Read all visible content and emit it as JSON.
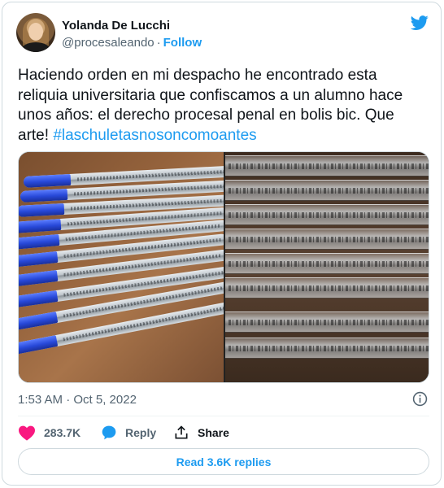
{
  "author": {
    "name": "Yolanda De Lucchi",
    "handle": "@procesaleando",
    "separator": "·",
    "follow_label": "Follow"
  },
  "tweet": {
    "text": "Haciendo orden en mi despacho he encontrado esta reliquia universitaria que confiscamos a un alumno hace unos años: el derecho procesal penal en bolis bic. Que arte! ",
    "hashtag": "#laschuletasnosoncomoantes",
    "timestamp": "1:53 AM · Oct 5, 2022"
  },
  "media": {
    "photos": [
      "blue-cap-pens-photo",
      "engraved-pen-closeup-photo"
    ]
  },
  "actions": {
    "like_count": "283.7K",
    "reply_label": "Reply",
    "share_label": "Share",
    "read_replies_label": "Read 3.6K replies"
  },
  "colors": {
    "accent": "#1d9bf0",
    "like": "#f91880",
    "text": "#0f1419",
    "muted": "#536471",
    "border": "#cfd9de"
  },
  "icons": [
    "twitter-bird-icon",
    "info-icon",
    "heart-icon",
    "reply-bubble-icon",
    "share-icon"
  ]
}
